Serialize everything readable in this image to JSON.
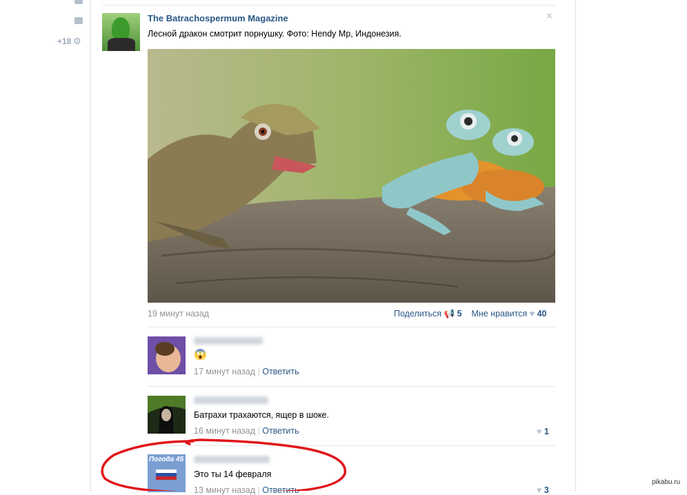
{
  "sidebar": {
    "count_label": "+18"
  },
  "post": {
    "author": "The Batrachospermum Magazine",
    "text": "Лесной дракон смотрит порнушку. Фото: Hendy Mp, Индонезия.",
    "timestamp": "19 минут назад",
    "share_label": "Поделиться",
    "share_count": "5",
    "like_label": "Мне нравится",
    "like_count": "40",
    "close_icon": "×"
  },
  "comments": [
    {
      "text": "",
      "emoji": "😱",
      "timestamp": "17 минут назад",
      "reply_label": "Ответить",
      "likes": ""
    },
    {
      "text": "Батрахи трахаются, ящер в шоке.",
      "timestamp": "16 минут назад",
      "reply_label": "Ответить",
      "likes": "1"
    },
    {
      "text": "Это ты 14 февраля",
      "avatar_text": "Погода 45",
      "timestamp": "13 минут назад",
      "reply_label": "Ответить",
      "likes": "3"
    }
  ],
  "separator": "|",
  "watermark": "pikabu.ru",
  "colors": {
    "link": "#2a5885",
    "meta": "#939393",
    "annotation": "#e0151a"
  }
}
